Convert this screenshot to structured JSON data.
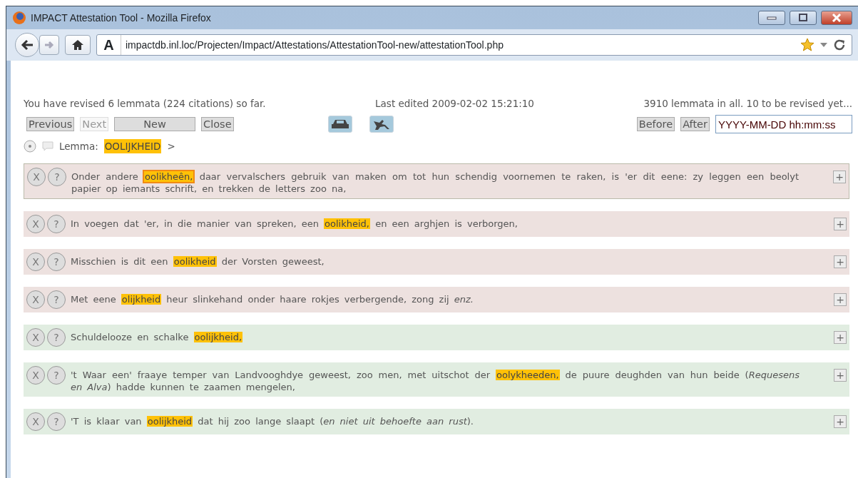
{
  "window": {
    "title": "IMPACT Attestation Tool - Mozilla Firefox"
  },
  "address_bar": {
    "url": "impactdb.inl.loc/Projecten/Impact/Attestations/AttestationTool-new/attestationTool.php",
    "site_badge": "A"
  },
  "status": {
    "revised": "You have revised 6 lemmata (224 citations) so far.",
    "last_edited": "Last edited 2009-02-02 15:21:10",
    "totals": "3910 lemmata in all. 10 to be revised yet..."
  },
  "nav_buttons": [
    {
      "label": "Previous",
      "disabled": false
    },
    {
      "label": "Next",
      "disabled": true
    },
    {
      "label": "New",
      "disabled": false
    },
    {
      "label": "Close",
      "disabled": false
    }
  ],
  "date_filter": {
    "buttons": [
      "Before",
      "After"
    ],
    "value": "YYYY-MM-DD hh:mm:ss"
  },
  "lemma": {
    "label": "Lemma:",
    "value": "OOLIJKHEID",
    "arrow": ">"
  },
  "citations": [
    {
      "accepted": false,
      "focused": true,
      "reject": "X",
      "question": "?",
      "expand": "+",
      "before": "Onder andere",
      "keyword": "oolikheên,",
      "after": "daar vervalschers gebruik van maken om tot hun schendig voornemen te raken, is 'er dit eene: zy leggen een beolyt papier op iemants schrift, en trekken de letters zoo na,"
    },
    {
      "accepted": false,
      "focused": false,
      "reject": "X",
      "question": "?",
      "expand": "+",
      "before": "In voegen dat 'er, in die manier van spreken, een",
      "keyword": "oolikheid,",
      "after": "en een arghjen is verborgen,"
    },
    {
      "accepted": false,
      "focused": false,
      "reject": "X",
      "question": "?",
      "expand": "+",
      "before": "Misschien is dit een",
      "keyword": "oolikheid",
      "after": "der Vorsten geweest,"
    },
    {
      "accepted": false,
      "focused": false,
      "reject": "X",
      "question": "?",
      "expand": "+",
      "before": "Met eene",
      "keyword": "olijkheid",
      "after": "heur slinkehand onder haare rokjes verbergende, zong zij *enz.*"
    },
    {
      "accepted": true,
      "focused": false,
      "reject": "X",
      "question": "?",
      "expand": "+",
      "before": "Schuldelooze en schalke",
      "keyword": "oolijkheid,"
    },
    {
      "accepted": true,
      "focused": false,
      "reject": "X",
      "question": "?",
      "expand": "+",
      "before": "'t Waar een' fraaye temper van Landvooghdye geweest, zoo men, met uitschot der",
      "keyword": "oolykheeden,",
      "after": "de puure deughden van hun beide (*Requesens en Alva*) hadde kunnen te zaamen mengelen,"
    },
    {
      "accepted": true,
      "focused": false,
      "reject": "X",
      "question": "?",
      "expand": "+",
      "before": "'T is klaar van",
      "keyword": "oolijkheid",
      "after": "dat hij zoo lange slaapt (*en niet uit behoefte aan rust*)."
    }
  ]
}
